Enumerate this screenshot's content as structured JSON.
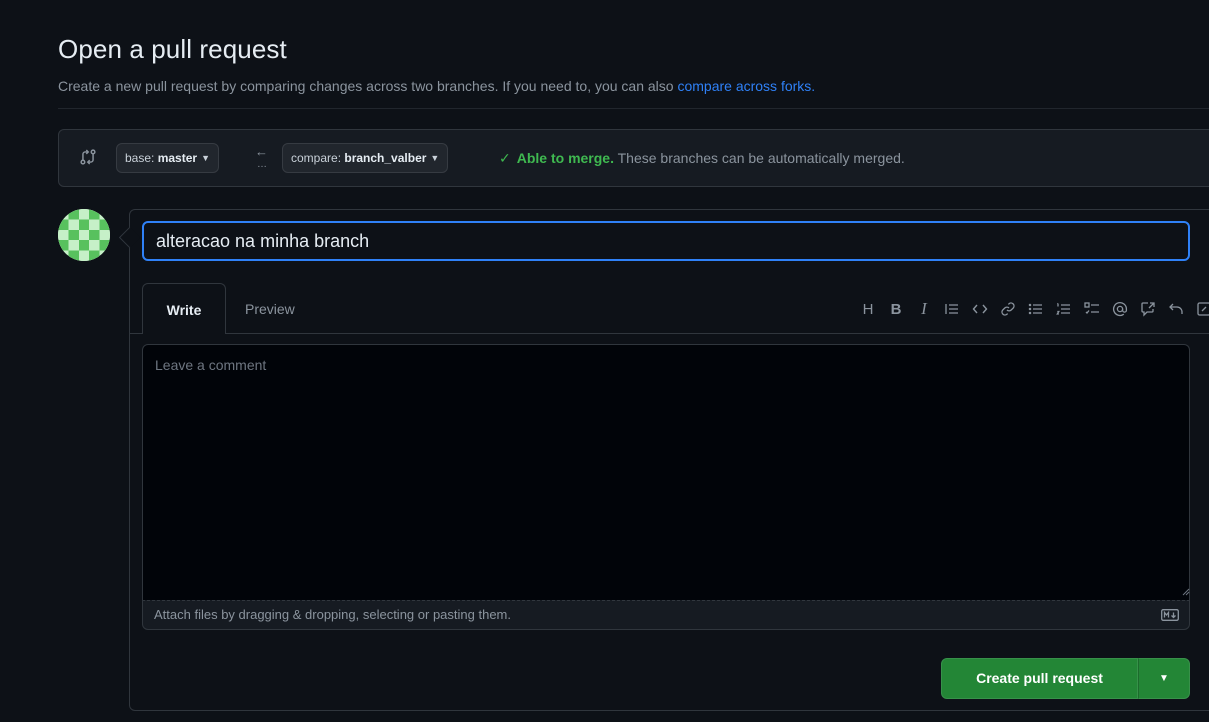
{
  "header": {
    "title": "Open a pull request",
    "subtitle": "Create a new pull request by comparing changes across two branches. If you need to, you can also",
    "subtitle_link": "compare across forks."
  },
  "compare": {
    "base_prefix": "base:",
    "base_branch": "master",
    "compare_prefix": "compare:",
    "compare_branch": "branch_valber",
    "merge_status_bold": "Able to merge.",
    "merge_status_text": "These branches can be automatically merged."
  },
  "form": {
    "title_value": "alteracao na minha branch",
    "tab_write": "Write",
    "tab_preview": "Preview",
    "comment_placeholder": "Leave a comment",
    "attach_text": "Attach files by dragging & dropping, selecting or pasting them.",
    "submit_label": "Create pull request"
  },
  "toolbar": {
    "heading_label": "H",
    "bold_label": "B",
    "italic_label": "I",
    "icons": [
      "heading-icon",
      "bold-icon",
      "italic-icon",
      "quote-icon",
      "code-icon",
      "link-icon",
      "unordered-list-icon",
      "ordered-list-icon",
      "task-list-icon",
      "mention-icon",
      "reference-icon",
      "undo-icon",
      "fullscreen-icon"
    ]
  },
  "colors": {
    "accent_blue": "#2f81f7",
    "success_green": "#3fb950",
    "button_green": "#238636",
    "background": "#0d1117"
  }
}
